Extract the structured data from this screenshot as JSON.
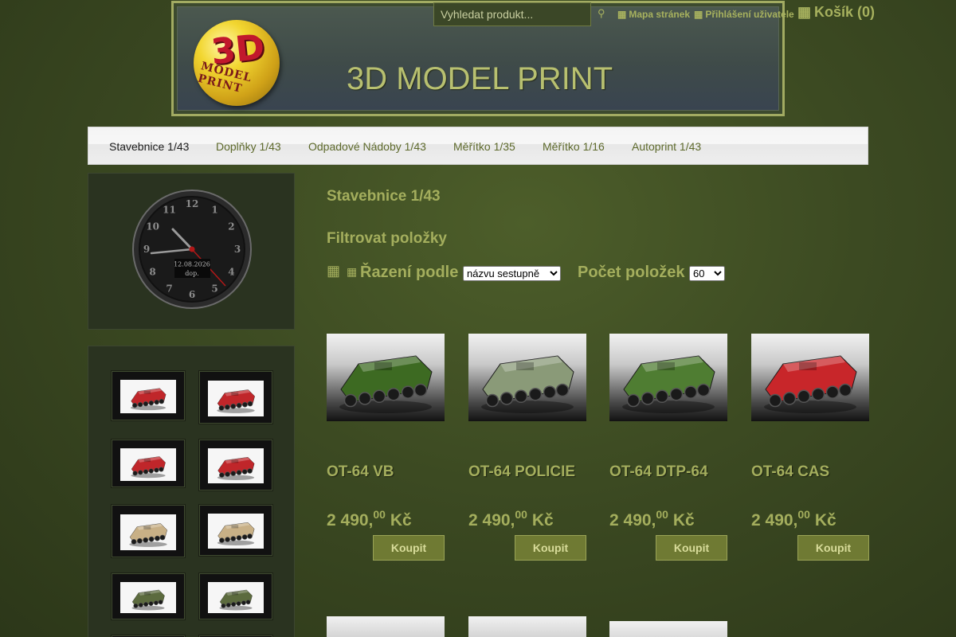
{
  "header": {
    "logo_text": "3D",
    "logo_sub": "MODEL PRINT",
    "site_title": "3D MODEL PRINT",
    "search_placeholder": "Vyhledat produkt...",
    "search_icon": "search-icon",
    "sitemap_label": "Mapa stránek",
    "login_label": "Přihlášení uživatele",
    "cart_label": "Košík (0)"
  },
  "nav": {
    "items": [
      {
        "label": "Stavebnice 1/43",
        "active": true
      },
      {
        "label": "Doplňky 1/43"
      },
      {
        "label": "Odpadové Nádoby 1/43"
      },
      {
        "label": "Měřítko 1/35"
      },
      {
        "label": "Měřítko 1/16"
      },
      {
        "label": "Autoprint 1/43"
      }
    ]
  },
  "clock": {
    "numbers": [
      "12",
      "1",
      "2",
      "3",
      "4",
      "5",
      "6",
      "7",
      "8",
      "9",
      "10",
      "11"
    ],
    "date": "12.08.2026",
    "ampm": "dop."
  },
  "main": {
    "title": "Stavebnice 1/43",
    "filter_title": "Filtrovat položky",
    "sort_label": "Řazení podle",
    "sort_value": "názvu sestupně",
    "count_label": "Počet položek",
    "count_value": "60"
  },
  "products": [
    {
      "name": "OT-64 VB",
      "price_main": "2 490,",
      "price_cents": "00",
      "currency": "Kč",
      "buy_label": "Koupit",
      "color": "#3d6a22"
    },
    {
      "name": "OT-64 POLICIE",
      "price_main": "2 490,",
      "price_cents": "00",
      "currency": "Kč",
      "buy_label": "Koupit",
      "color": "#8a9a78"
    },
    {
      "name": "OT-64 DTP-64",
      "price_main": "2 490,",
      "price_cents": "00",
      "currency": "Kč",
      "buy_label": "Koupit",
      "color": "#4f7d32"
    },
    {
      "name": "OT-64 CAS",
      "price_main": "2 490,",
      "price_cents": "00",
      "currency": "Kč",
      "buy_label": "Koupit",
      "color": "#c8262a"
    }
  ],
  "thumbnails": [
    {
      "color": "#c0262a"
    },
    {
      "color": "#c0262a"
    },
    {
      "color": "#c0262a"
    },
    {
      "color": "#c0262a"
    },
    {
      "color": "#c8b086"
    },
    {
      "color": "#c8b086"
    },
    {
      "color": "#5c6b3e"
    },
    {
      "color": "#5c6b3e"
    }
  ]
}
